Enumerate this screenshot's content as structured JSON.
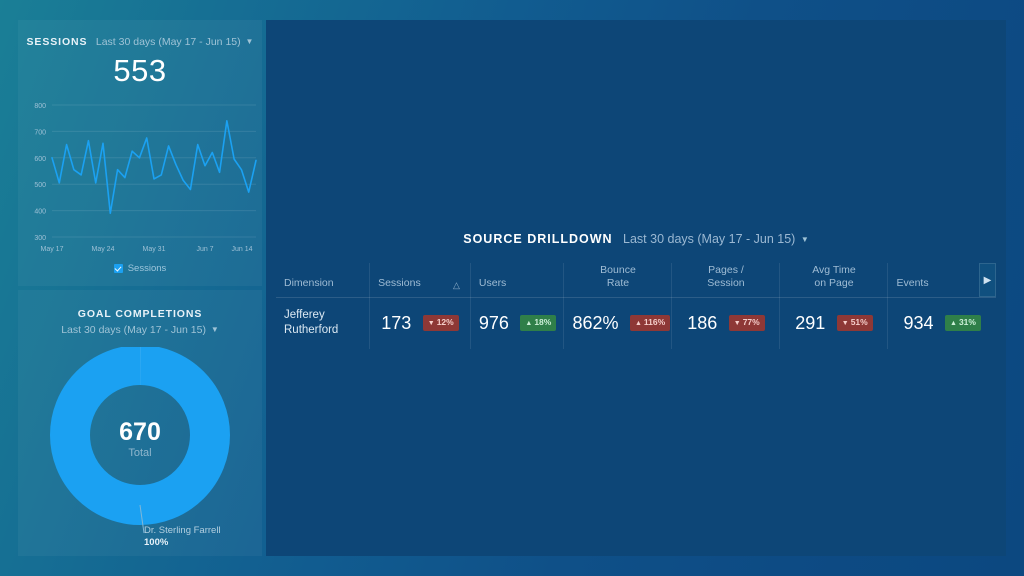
{
  "theme": {
    "accent": "#1ba1f2",
    "panel_bg": "#0d4677",
    "positive": "#2f7f49",
    "negative": "#8e3836"
  },
  "sessions_card": {
    "title": "SESSIONS",
    "range": "Last 30 days (May 17 - Jun 15)",
    "caret": "⌄",
    "big_number": "553",
    "legend": [
      {
        "label": "Sessions",
        "color": "#1ba1f2",
        "checked": true
      }
    ]
  },
  "goal_card": {
    "title": "GOAL COMPLETIONS",
    "range": "Last 30 days (May 17 - Jun 15)",
    "caret": "⌄",
    "total_value": "670",
    "total_label": "Total",
    "callout_name": "Dr. Sterling Farrell",
    "callout_pct": "100%"
  },
  "drilldown": {
    "title": "SOURCE DRILLDOWN",
    "range": "Last 30 days (May 17 - Jun 15)",
    "caret": "⌄",
    "scroll_right_icon": "▶",
    "sort_icon": "△",
    "columns": [
      {
        "label": "Dimension",
        "align": "left",
        "sorted": false
      },
      {
        "label": "Sessions",
        "align": "left",
        "sorted": true
      },
      {
        "label": "Users",
        "align": "left",
        "sorted": false
      },
      {
        "label": "Bounce\nRate",
        "align": "center",
        "sorted": false
      },
      {
        "label": "Pages /\nSession",
        "align": "center",
        "sorted": false
      },
      {
        "label": "Avg Time\non Page",
        "align": "center",
        "sorted": false
      },
      {
        "label": "Events",
        "align": "left",
        "sorted": false
      }
    ],
    "column_labels": {
      "dimension": "Dimension",
      "sessions": "Sessions",
      "users": "Users",
      "bounce_rate_l1": "Bounce",
      "bounce_rate_l2": "Rate",
      "pages_session_l1": "Pages /",
      "pages_session_l2": "Session",
      "avg_time_l1": "Avg Time",
      "avg_time_l2": "on Page",
      "events": "Events"
    },
    "rows": [
      {
        "dimension_l1": "Jefferey",
        "dimension_l2": "Rutherford",
        "sessions": {
          "value": "173",
          "delta": "12%",
          "dir": "down",
          "tone": "bad"
        },
        "users": {
          "value": "976",
          "delta": "18%",
          "dir": "up",
          "tone": "good"
        },
        "bounce_rate": {
          "value": "862%",
          "delta": "116%",
          "dir": "up",
          "tone": "bad"
        },
        "pages_session": {
          "value": "186",
          "delta": "77%",
          "dir": "down",
          "tone": "bad"
        },
        "avg_time": {
          "value": "291",
          "delta": "51%",
          "dir": "down",
          "tone": "bad"
        },
        "events": {
          "value": "934",
          "delta": "31%",
          "dir": "up",
          "tone": "good"
        }
      }
    ]
  },
  "chart_data": [
    {
      "type": "line",
      "title": "Sessions",
      "xlabel": "",
      "ylabel": "",
      "ylim": [
        300,
        800
      ],
      "yticks": [
        300,
        400,
        500,
        600,
        700,
        800
      ],
      "xticks": [
        "May 17",
        "May 24",
        "May 31",
        "Jun 7",
        "Jun 14"
      ],
      "grid": true,
      "legend": [
        "Sessions"
      ],
      "series": [
        {
          "name": "Sessions",
          "color": "#1ba1f2",
          "values": [
            600,
            505,
            650,
            555,
            535,
            665,
            505,
            655,
            390,
            555,
            525,
            625,
            600,
            675,
            520,
            535,
            645,
            575,
            515,
            480,
            650,
            570,
            620,
            545,
            740,
            595,
            555,
            470,
            590
          ]
        }
      ]
    },
    {
      "type": "pie",
      "variant": "donut",
      "title": "Goal Completions",
      "center_value": "670",
      "center_label": "Total",
      "labels": [
        "Dr. Sterling Farrell"
      ],
      "values": [
        670
      ],
      "percentages": [
        "100%"
      ],
      "colors": [
        "#1ba1f2"
      ]
    }
  ]
}
